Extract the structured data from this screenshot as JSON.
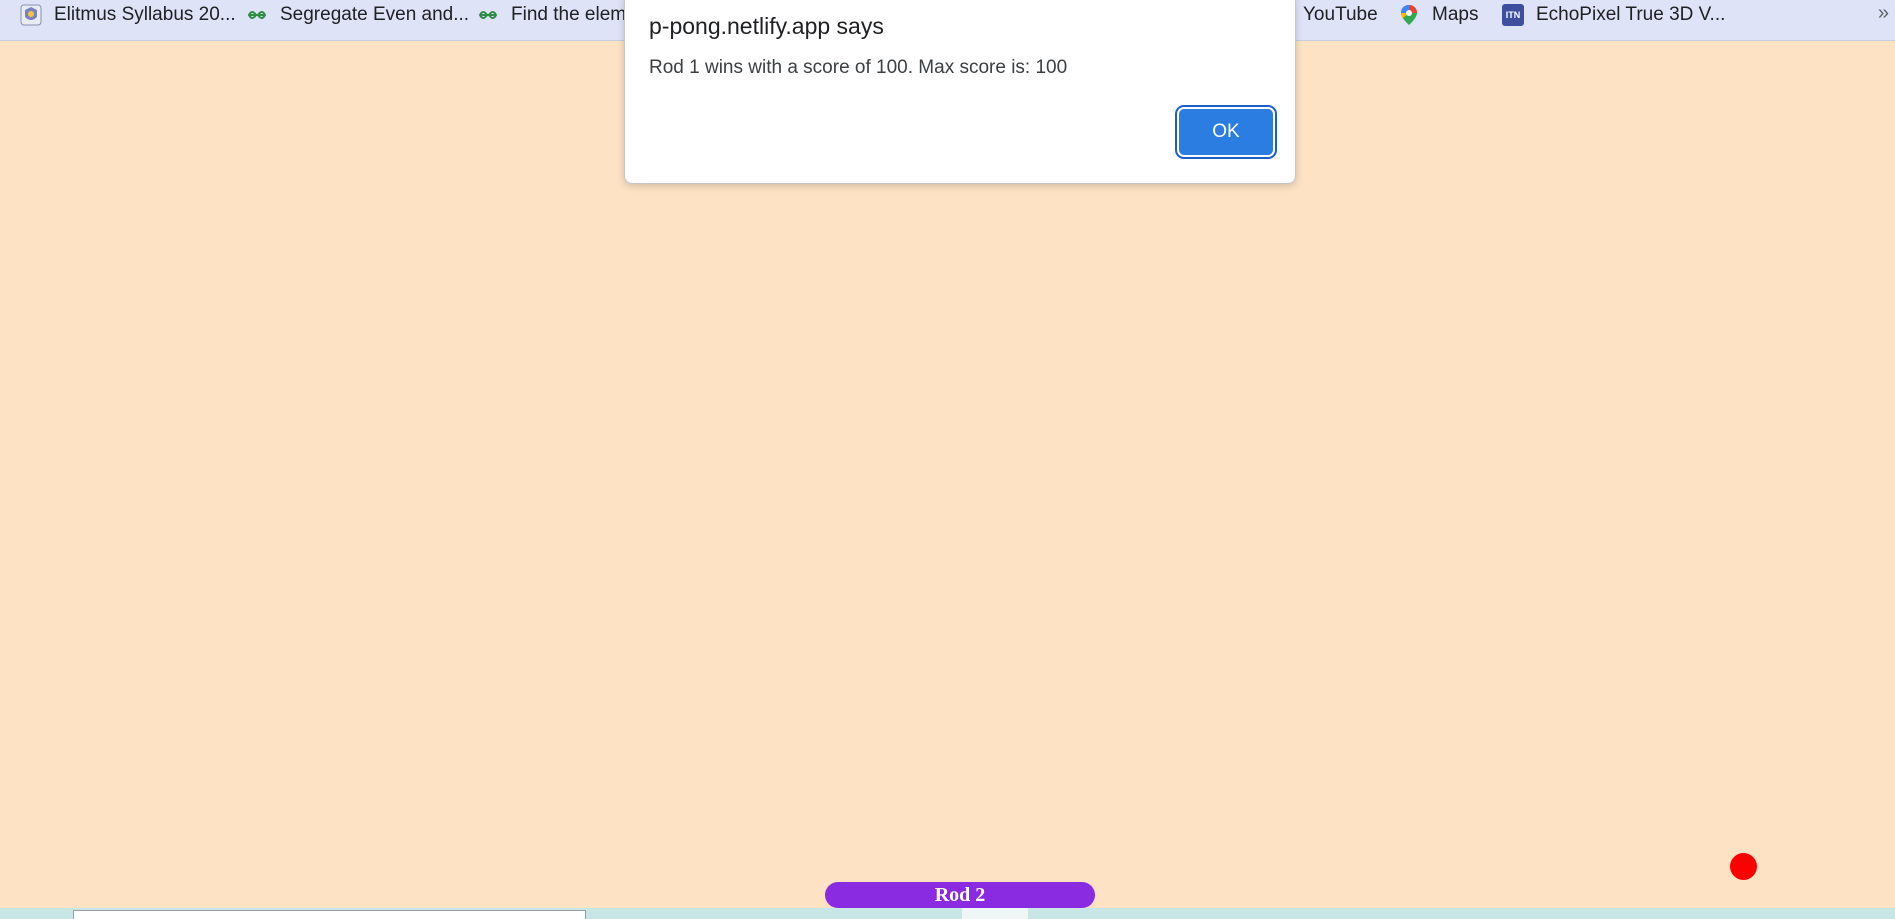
{
  "bookmarks": [
    {
      "label": "Elitmus Syllabus 20...",
      "icon": "elitmus-logo-icon"
    },
    {
      "label": "Segregate Even and...",
      "icon": "geeksforgeeks-icon"
    },
    {
      "label": "Find the eleme",
      "icon": "geeksforgeeks-icon"
    },
    {
      "label": "YouTube",
      "icon": ""
    },
    {
      "label": "Maps",
      "icon": "google-maps-pin-icon"
    },
    {
      "label": "EchoPixel True 3D V...",
      "icon": "echopixel-itn-icon"
    }
  ],
  "bookmarks_more": "»",
  "echopixel_icon_text": "ITN",
  "alert": {
    "title": "p-pong.netlify.app says",
    "message": "Rod 1 wins with a score of 100. Max score is: 100",
    "ok_label": "OK"
  },
  "game": {
    "rod_2_label": "Rod 2",
    "rod_color": "#8a2be2",
    "ball_color": "#ff0000",
    "background_color": "#fde3c4"
  }
}
